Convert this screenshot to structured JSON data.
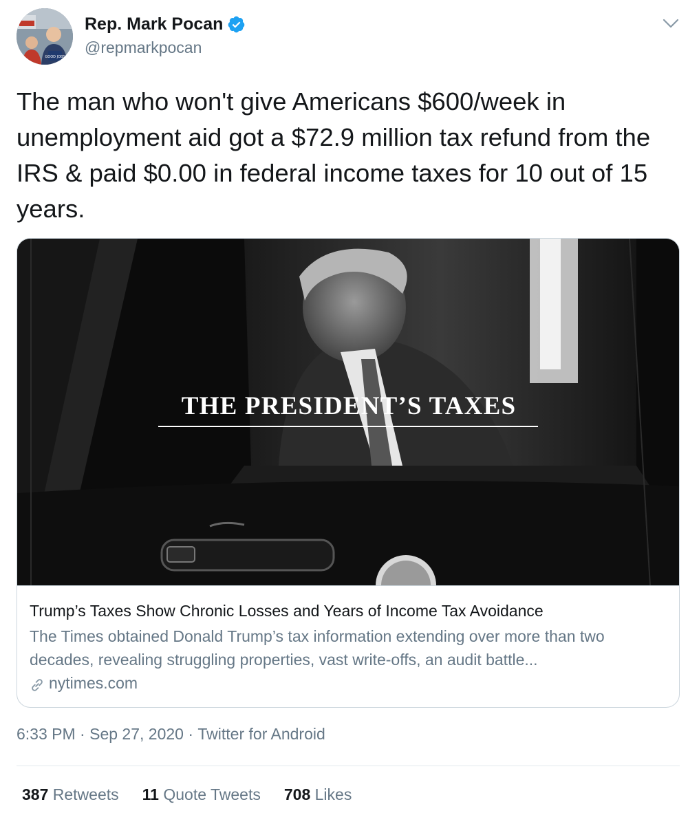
{
  "author": {
    "display_name": "Rep. Mark Pocan",
    "handle": "@repmarkpocan",
    "verified": true,
    "avatar_text": "GOOD JOBS"
  },
  "tweet": {
    "text": "The man who won't give Americans $600/week in unemployment aid got a $72.9 million tax refund from the IRS & paid $0.00 in federal income taxes for 10 out of 15 years."
  },
  "card": {
    "image_headline": "THE PRESIDENT’S TAXES",
    "title": "Trump’s Taxes Show Chronic Losses and Years of Income Tax Avoidance",
    "description": "The Times obtained Donald Trump’s tax information extending over more than two decades, revealing struggling properties, vast write-offs, an audit battle...",
    "domain": "nytimes.com"
  },
  "meta": {
    "time": "6:33 PM",
    "separator": " · ",
    "date": "Sep 27, 2020",
    "source": "Twitter for Android"
  },
  "stats": {
    "retweets_count": "387",
    "retweets_label": "Retweets",
    "quotes_count": "11",
    "quotes_label": "Quote Tweets",
    "likes_count": "708",
    "likes_label": "Likes"
  },
  "colors": {
    "verified_blue": "#1da1f2",
    "secondary_text": "#657786",
    "border": "#ccd6dd"
  }
}
